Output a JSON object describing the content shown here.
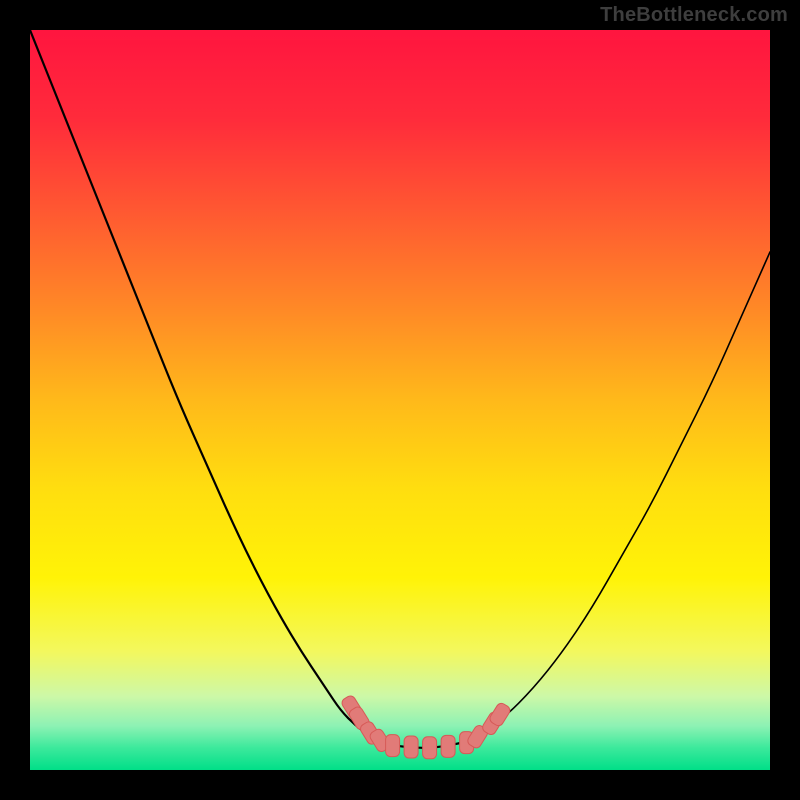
{
  "watermark": "TheBottleneck.com",
  "chart_data": {
    "type": "line",
    "title": "",
    "xlabel": "",
    "ylabel": "",
    "xlim": [
      0,
      100
    ],
    "ylim": [
      0,
      100
    ],
    "grid": false,
    "legend": false,
    "series": [
      {
        "name": "left-curve",
        "x": [
          0,
          4,
          8,
          12,
          16,
          20,
          24,
          28,
          32,
          36,
          40,
          42,
          44,
          46,
          48
        ],
        "y": [
          100,
          90,
          80,
          70,
          60,
          50,
          41,
          32,
          24,
          17,
          11,
          8,
          6,
          4.5,
          3.5
        ]
      },
      {
        "name": "valley-floor",
        "x": [
          48,
          50,
          52,
          54,
          56,
          58,
          60
        ],
        "y": [
          3.5,
          3.2,
          3.0,
          3.0,
          3.2,
          3.6,
          4.2
        ]
      },
      {
        "name": "right-curve",
        "x": [
          60,
          64,
          68,
          72,
          76,
          80,
          84,
          88,
          92,
          96,
          100
        ],
        "y": [
          4.2,
          7,
          11,
          16,
          22,
          29,
          36,
          44,
          52,
          61,
          70
        ]
      }
    ],
    "markers": [
      {
        "name": "left-cluster-upper-1",
        "x": 43.5,
        "y": 8.5
      },
      {
        "name": "left-cluster-upper-2",
        "x": 44.5,
        "y": 7.0
      },
      {
        "name": "left-cluster-lower-1",
        "x": 46.0,
        "y": 5.0
      },
      {
        "name": "left-cluster-lower-2",
        "x": 47.3,
        "y": 4.0
      },
      {
        "name": "floor-1",
        "x": 49.0,
        "y": 3.3
      },
      {
        "name": "floor-2",
        "x": 51.5,
        "y": 3.1
      },
      {
        "name": "floor-3",
        "x": 54.0,
        "y": 3.0
      },
      {
        "name": "floor-4",
        "x": 56.5,
        "y": 3.2
      },
      {
        "name": "floor-5",
        "x": 59.0,
        "y": 3.7
      },
      {
        "name": "right-cluster-lower",
        "x": 60.5,
        "y": 4.5
      },
      {
        "name": "right-cluster-upper-1",
        "x": 62.5,
        "y": 6.3
      },
      {
        "name": "right-cluster-upper-2",
        "x": 63.5,
        "y": 7.5
      }
    ],
    "gradient_stops": [
      {
        "offset": 0.0,
        "color": "#ff153f"
      },
      {
        "offset": 0.12,
        "color": "#ff2b3b"
      },
      {
        "offset": 0.25,
        "color": "#ff5a31"
      },
      {
        "offset": 0.38,
        "color": "#ff8a26"
      },
      {
        "offset": 0.5,
        "color": "#ffb91a"
      },
      {
        "offset": 0.62,
        "color": "#ffde0f"
      },
      {
        "offset": 0.74,
        "color": "#fff307"
      },
      {
        "offset": 0.84,
        "color": "#f3f85e"
      },
      {
        "offset": 0.9,
        "color": "#cdf8a7"
      },
      {
        "offset": 0.94,
        "color": "#8ef2b4"
      },
      {
        "offset": 0.97,
        "color": "#3ce99c"
      },
      {
        "offset": 1.0,
        "color": "#00df88"
      }
    ],
    "marker_style": {
      "fill": "#e17b78",
      "stroke": "#d65a57",
      "rx": 5
    },
    "line_style": {
      "stroke": "#000000",
      "width_main": 2.2,
      "width_thin": 1.6
    }
  }
}
